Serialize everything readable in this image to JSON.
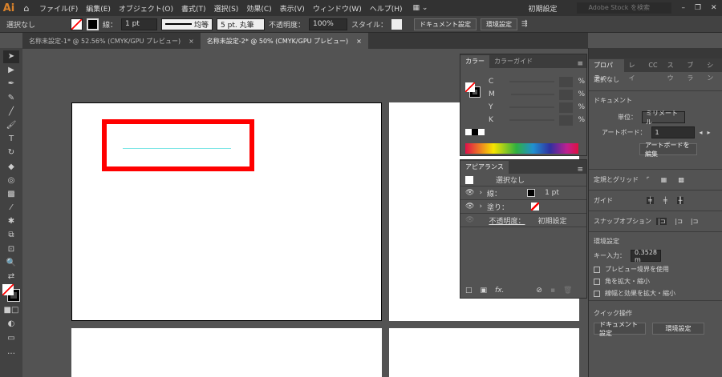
{
  "menu": {
    "logo": "Ai",
    "items": [
      "ファイル(F)",
      "編集(E)",
      "オブジェクト(O)",
      "書式(T)",
      "選択(S)",
      "効果(C)",
      "表示(V)",
      "ウィンドウ(W)",
      "ヘルプ(H)"
    ],
    "workspace": "初期設定",
    "search_placeholder": "Adobe Stock を検索"
  },
  "control": {
    "selection": "選択なし",
    "stroke_label": "線：",
    "stroke_weight": "1 pt",
    "stroke_profile": "均等",
    "brush": "5 pt. 丸筆",
    "opacity_label": "不透明度：",
    "opacity": "100%",
    "style_label": "スタイル：",
    "doc_settings": "ドキュメント設定",
    "preferences": "環境設定"
  },
  "doc_tabs": [
    {
      "label": "名称未設定-1* @ 52.56% (CMYK/GPU プレビュー)",
      "close": "×"
    },
    {
      "label": "名称未設定-2* @ 50% (CMYK/GPU プレビュー)",
      "close": "×"
    }
  ],
  "color_panel": {
    "tabs": [
      "カラー",
      "カラーガイド"
    ],
    "channels": [
      "C",
      "M",
      "Y",
      "K"
    ],
    "unit": "%"
  },
  "appearance_panel": {
    "title": "アピアランス",
    "selection": "選択なし",
    "stroke_label": "線：",
    "stroke_value": "1 pt",
    "fill_label": "塗り：",
    "opacity_label": "不透明度：",
    "opacity_value": "初期設定",
    "fx": "fx."
  },
  "properties": {
    "tabs": [
      "プロパティ",
      "レイ",
      "CC",
      "スウ",
      "ブラ",
      "シン"
    ],
    "selection": "選択なし",
    "document_heading": "ドキュメント",
    "units_label": "単位：",
    "units_value": "ミリメートル",
    "artboard_label": "アートボード：",
    "artboard_value": "1",
    "edit_artboards": "アートボードを編集",
    "rulers_grids": "定規とグリッド",
    "guides": "ガイド",
    "snap_options": "スナップオプション",
    "preferences_heading": "環境設定",
    "key_increment_label": "キー入力：",
    "key_increment_value": "0.3528 m",
    "checkboxes": [
      "プレビュー境界を使用",
      "角を拡大・縮小",
      "線幅と効果を拡大・縮小"
    ],
    "quick_actions": "クイック操作",
    "doc_settings": "ドキュメント設定",
    "preferences": "環境設定"
  },
  "colors": {
    "selection_red": "#ff0000",
    "line_cyan": "#7fe6e6"
  }
}
